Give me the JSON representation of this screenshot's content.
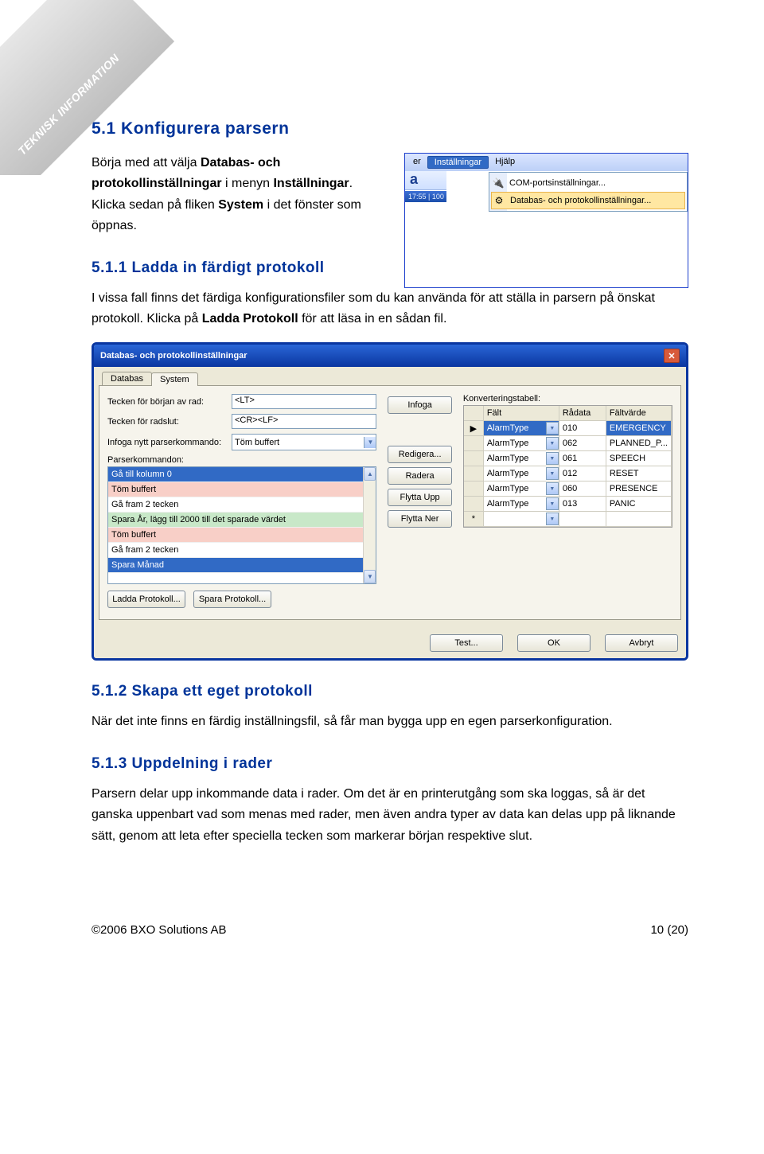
{
  "ribbon": "TEKNISK INFORMATION",
  "doc": {
    "h2": "5.1 Konfigurera parsern",
    "p1a": "Börja med att välja ",
    "p1b": "Databas- och protokollinställningar",
    "p1c": " i menyn ",
    "p1d": "Inställningar",
    "p1e": ". Klicka sedan på fliken ",
    "p1f": "System",
    "p1g": " i det fönster som öppnas.",
    "h3a": "5.1.1  Ladda in färdigt protokoll",
    "p2a": "I vissa fall finns det färdiga konfigurationsfiler som du kan använda för att ställa in parsern på önskat protokoll. Klicka på ",
    "p2b": "Ladda Protokoll",
    "p2c": " för att läsa in en sådan fil.",
    "h3b": "5.1.2  Skapa ett eget protokoll",
    "p3": "När det inte finns en färdig inställningsfil, så får man bygga upp en egen parserkonfiguration.",
    "h3c": "5.1.3  Uppdelning i rader",
    "p4": "Parsern delar upp inkommande data i rader. Om det är en printerutgång som ska loggas, så är det ganska uppenbart vad som menas med rader, men även andra typer av data kan delas upp på liknande sätt, genom att leta efter speciella tecken som markerar början respektive slut."
  },
  "menu": {
    "bar": {
      "er": "er",
      "inst": "Inställningar",
      "hjalp": "Hjälp"
    },
    "za": "a",
    "items": [
      {
        "icon": "🔌",
        "label": "COM-portsinställningar..."
      },
      {
        "icon": "⚙",
        "label": "Databas- och protokollinställningar..."
      }
    ],
    "bluebar": "  17:55 | 100"
  },
  "dlg": {
    "title": "Databas- och protokollinställningar",
    "tabs": [
      "Databas",
      "System"
    ],
    "left": {
      "l1": "Tecken för början av rad:",
      "v1": "<LT>",
      "l2": "Tecken för radslut:",
      "v2": "<CR><LF>",
      "l3": "Infoga nytt parserkommando:",
      "v3": "Töm buffert",
      "l4": "Parserkommandon:",
      "list": [
        {
          "t": "Gå till kolumn 0",
          "c": "sel-row"
        },
        {
          "t": "Töm buffert",
          "c": "pink"
        },
        {
          "t": "Gå fram 2 tecken",
          "c": ""
        },
        {
          "t": "Spara År, lägg till 2000 till det sparade värdet",
          "c": "green"
        },
        {
          "t": "Töm buffert",
          "c": "pink"
        },
        {
          "t": "Gå fram 2 tecken",
          "c": ""
        },
        {
          "t": "Spara Månad",
          "c": "sel-row"
        }
      ],
      "b1": "Ladda Protokoll...",
      "b2": "Spara Protokoll..."
    },
    "mid": {
      "infoga": "Infoga",
      "red": "Redigera...",
      "rad": "Radera",
      "upp": "Flytta Upp",
      "ner": "Flytta Ner"
    },
    "right": {
      "lbl": "Konverteringstabell:",
      "head": [
        "Fält",
        "Rådata",
        "Fältvärde"
      ],
      "rows": [
        [
          "AlarmType",
          "010",
          "EMERGENCY"
        ],
        [
          "AlarmType",
          "062",
          "PLANNED_P..."
        ],
        [
          "AlarmType",
          "061",
          "SPEECH"
        ],
        [
          "AlarmType",
          "012",
          "RESET"
        ],
        [
          "AlarmType",
          "060",
          "PRESENCE"
        ],
        [
          "AlarmType",
          "013",
          "PANIC"
        ]
      ],
      "star": "*"
    },
    "footer": {
      "test": "Test...",
      "ok": "OK",
      "avbryt": "Avbryt"
    }
  },
  "footer": {
    "left": "©2006 BXO Solutions AB",
    "right": "10 (20)"
  }
}
